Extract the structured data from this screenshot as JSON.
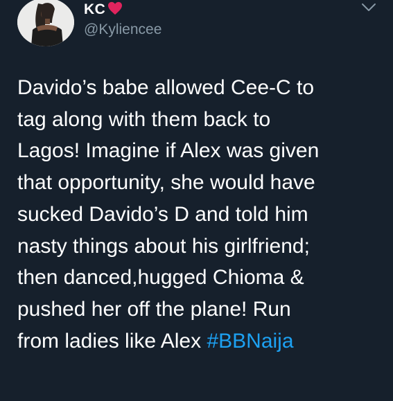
{
  "user": {
    "display_name": "KC",
    "handle": "@Kyliencee"
  },
  "tweet": {
    "lines": [
      "Davido’s babe allowed Cee-C to",
      "tag along with them back to",
      "Lagos! Imagine if Alex was given",
      "that opportunity, she would have",
      "sucked Davido’s D and told him",
      "nasty things about his girlfriend;",
      "then danced,hugged Chioma &",
      "pushed her off the plane! Run"
    ],
    "last_line_text": "from ladies like Alex ",
    "hashtag": "#BBNaija"
  },
  "icons": {
    "name_emoji": "heart-icon",
    "menu": "chevron-down-icon"
  },
  "colors": {
    "background": "#16202c",
    "text": "#ffffff",
    "handle": "#8899a6",
    "hashtag": "#1da1f2",
    "heart": "#e0245e"
  }
}
